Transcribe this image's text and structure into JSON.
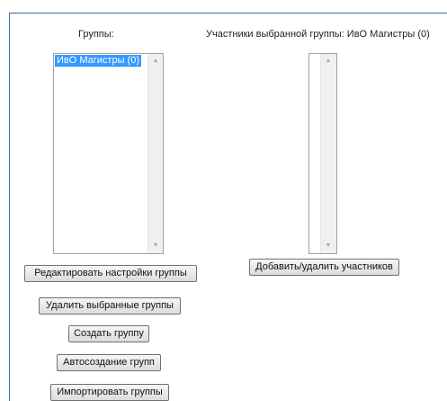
{
  "left_panel": {
    "title": "Группы:",
    "groups": [
      "ИвО Магистры (0)"
    ],
    "buttons": {
      "edit": "Редактировать настройки группы",
      "delete": "Удалить выбранные группы",
      "create": "Создать группу",
      "autocreate": "Автосоздание групп",
      "import": "Импортировать группы"
    }
  },
  "right_panel": {
    "title": "Участники выбранной группы: ИвО Магистры (0)",
    "members": [],
    "buttons": {
      "add_remove": "Добавить/удалить участников"
    }
  },
  "colors": {
    "selection": "#3399ff",
    "frame_border": "#3a6ea5"
  },
  "icons": {
    "scroll_up": "▲",
    "scroll_down": "▼"
  }
}
